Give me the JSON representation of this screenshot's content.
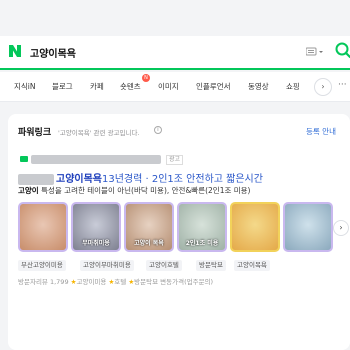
{
  "search": {
    "query": "고양이목욕",
    "logo_letter": "N"
  },
  "tabs": [
    {
      "label": "지식iN"
    },
    {
      "label": "블로그"
    },
    {
      "label": "카페"
    },
    {
      "label": "숏텐츠"
    },
    {
      "label": "이미지"
    },
    {
      "label": "인플루언서"
    },
    {
      "label": "동영상"
    },
    {
      "label": "쇼핑"
    }
  ],
  "tab_next_label": "›",
  "tab_more_label": "···",
  "powerlink": {
    "title": "파워링크",
    "subtitle": "'고양이목욕' 관련 광고입니다.",
    "register_label": "등록 안내",
    "info_label": "i"
  },
  "ad": {
    "tag_label": "광고",
    "title_strong": "고양이목욕",
    "title_rest": "13년경력 · 2인1조 안전하고 짧은시간",
    "desc_strong": "고양이",
    "desc_rest": " 특성을 고려한 테이블이 아닌(바닥 미용), 안전&빠른(2인1조 미용)",
    "thumbnails": [
      {
        "caption": "",
        "colors": [
          "#e9c7b4",
          "#c88d6a"
        ],
        "border": "#c9b8ef"
      },
      {
        "caption": "무마취미용",
        "colors": [
          "#c9ccd8",
          "#7e8090"
        ],
        "border": "#c9b8ef"
      },
      {
        "caption": "고양이 목욕",
        "colors": [
          "#e7d2c2",
          "#b58e72"
        ],
        "border": "#c9b8ef"
      },
      {
        "caption": "2인1조 미용",
        "colors": [
          "#d7e2da",
          "#9fb1a6"
        ],
        "border": "#c9b8ef"
      },
      {
        "caption": "",
        "colors": [
          "#f4d98a",
          "#e4a949"
        ],
        "border": "#f2d25a"
      },
      {
        "caption": "",
        "colors": [
          "#cfe1eb",
          "#8ba9bd"
        ],
        "border": "#c9b8ef"
      }
    ],
    "carousel_next": "›",
    "chips": [
      "부산고양이미용",
      "고양이무마취미용",
      "고양이호텔",
      "방문탁묘",
      "고양이목욕"
    ],
    "meta": {
      "visits_label": "방문자리뷰 1,799",
      "items": [
        "고양이미용",
        "호텔",
        "방문탁묘 변동가격(업주문의)"
      ]
    }
  },
  "colors": {
    "naver_green": "#03c75a",
    "link_blue": "#2a57c9",
    "badge_red": "#ff5a4a"
  }
}
